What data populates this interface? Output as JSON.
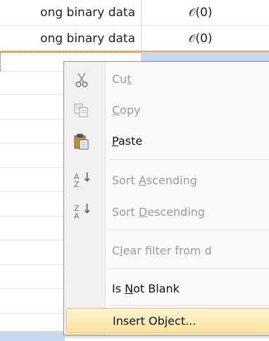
{
  "table": {
    "rows": [
      {
        "text": "ong binary data",
        "attachment": "📎(0)"
      },
      {
        "text": "ong binary data",
        "attachment": "📎(0)"
      }
    ],
    "attach_label_0": "(0)",
    "attach_label_1": "(0)"
  },
  "menu": {
    "items": [
      {
        "label": "Cut",
        "mnemonic": "t",
        "icon": "scissors-icon",
        "enabled": false
      },
      {
        "label": "Copy",
        "mnemonic": "C",
        "icon": "copy-icon",
        "enabled": false
      },
      {
        "label": "Paste",
        "mnemonic": "P",
        "icon": "paste-icon",
        "enabled": true
      },
      {
        "label": "Sort Ascending",
        "mnemonic": "A",
        "icon": "sort-ascending-icon",
        "enabled": false
      },
      {
        "label": "Sort Descending",
        "mnemonic": "D",
        "icon": "sort-descending-icon",
        "enabled": false
      },
      {
        "label": "Clear filter from d",
        "mnemonic": "l",
        "icon": "",
        "enabled": false
      },
      {
        "label": "Is Not Blank",
        "mnemonic": "N",
        "icon": "",
        "enabled": true
      },
      {
        "label": "Insert Object...",
        "mnemonic": "",
        "icon": "",
        "enabled": true,
        "highlighted": true
      }
    ]
  },
  "colors": {
    "highlight": "#fbe39b",
    "selection": "#c7d9f0",
    "current_row_border": "#e8b13c"
  }
}
